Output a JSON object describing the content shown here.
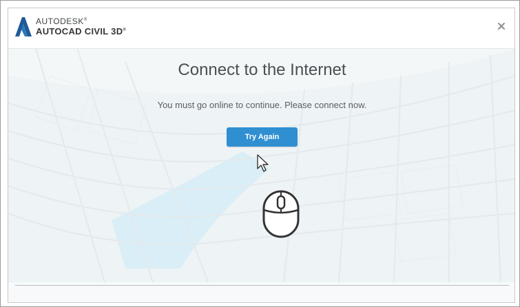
{
  "brand": {
    "company": "AUTODESK",
    "product": "AUTOCAD CIVIL 3D",
    "company_mark": "®",
    "product_mark": "®"
  },
  "dialog": {
    "title": "Connect to the Internet",
    "message": "You must go online to continue. Please connect now.",
    "try_again_label": "Try Again"
  },
  "icons": {
    "logo": "autodesk-a-icon",
    "close": "close-icon",
    "cursor": "arrow-cursor-icon",
    "mouse": "mouse-click-icon"
  },
  "colors": {
    "accent": "#2f8fd1",
    "logo": "#1f5a96",
    "title_text": "#4b4f53"
  }
}
